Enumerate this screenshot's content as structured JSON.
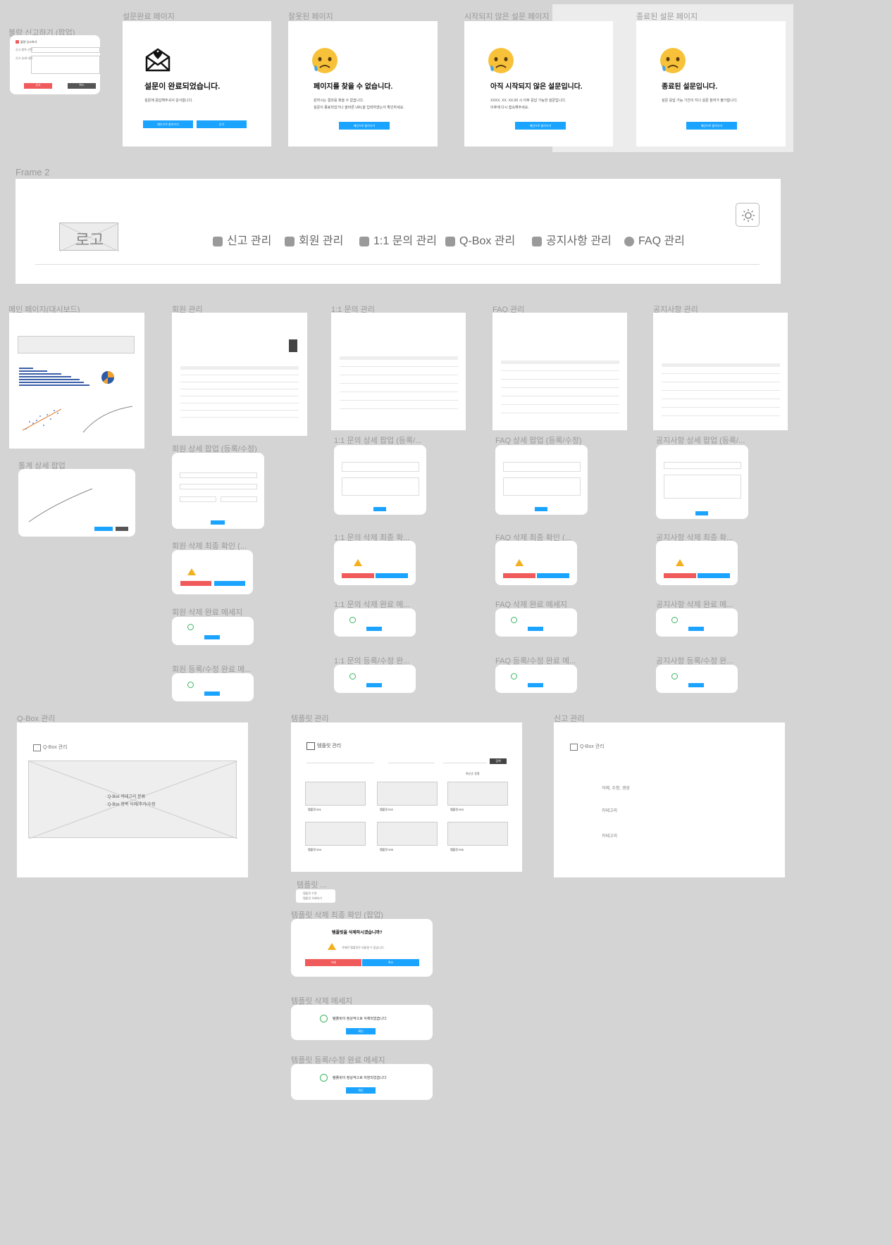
{
  "top": {
    "report_popup": {
      "label": "불량 신고하기 (팝업)",
      "title": "불량 신고하기",
      "field1": "신고 항목 선택",
      "field2": "신고 상세 내용",
      "cancel": "신고",
      "confirm": "취소"
    },
    "complete": {
      "label": "설문완료 페이지",
      "heading": "설문이 완료되었습니다.",
      "sub": "설문에 응답해주셔서 감사합니다.",
      "btn1": "메인으로 돌아가기",
      "btn2": "닫기"
    },
    "notfound": {
      "label": "잘못된 페이지",
      "heading": "페이지를 찾을 수 없습니다.",
      "sub1": "원하시는 결과를 찾을 수 없습니다.",
      "sub2": "설문이 종료되었거나 올바른 URL을 입력하였는지 확인하세요.",
      "btn": "메인으로 돌아가기"
    },
    "notstarted": {
      "label": "시작되지 않은 설문 페이지",
      "heading": "아직 시작되지 않은 설문입니다.",
      "sub1": "XXXX. XX. XX.00 시 이후 응답 가능한 설문입니다.",
      "sub2": "이후에 다시 접속해주세요.",
      "btn": "메인으로 돌아가기"
    },
    "ended": {
      "label": "종료된 설문 페이지",
      "heading": "종료된 설문입니다.",
      "sub": "설문 응답 가능 기간이 지나 설문 참여가 불가합니다.",
      "btn": "메인으로 돌아가기"
    }
  },
  "frame2": {
    "label": "Frame 2",
    "logo": "로고",
    "nav": [
      "신고 관리",
      "회원 관리",
      "1:1 문의 관리",
      "Q-Box 관리",
      "공지사항 관리",
      "FAQ 관리"
    ]
  },
  "labels": {
    "dashboard": "메인 페이지(대시보드)",
    "members": "회원 관리",
    "inquiry": "1:1 문의 관리",
    "faq": "FAQ 관리",
    "notice": "공지사항 관리",
    "stats_popup": "통계 상세 팝업",
    "member_detail": "회원 상세 팝업 (등록/수정)",
    "member_delete_confirm": "회원 삭제 최종 확인 (...",
    "member_delete_done": "회원 삭제 완료 메세지",
    "member_save_done": "회원 등록/수정 완료 메...",
    "inquiry_detail": "1:1 문의 상세 팝업 (등록/...",
    "faq_detail": "FAQ 상세 팝업 (등록/수정)",
    "notice_detail": "공지사항 상세 팝업 (등록/...",
    "inquiry_delete_confirm": "1:1 문의 삭제 최종 확...",
    "faq_delete_confirm": "FAQ 삭제 최종 확인 (...",
    "notice_delete_confirm": "공지사항 삭제 최종 확...",
    "inquiry_delete_done": "1:1 문의 삭제 완료 메...",
    "faq_delete_done": "FAQ 삭제 완료 메세지",
    "notice_delete_done": "공지사항 삭제 완료 메...",
    "inquiry_save_done": "1:1 문의 등록/수정 완...",
    "faq_save_done": "FAQ 등록/수정 완료 메...",
    "notice_save_done": "공지사항 등록/수정 완...",
    "qbox": "Q-Box 관리",
    "template": "템플릿 관리",
    "report": "신고 관리",
    "template_menu": "템플릿 ...",
    "template_delete_confirm": "템플릿 삭제 최종 확인 (팝업)",
    "template_delete_msg": "템플릿 삭제 메세지",
    "template_save_msg": "템플릿 등록/수정 완료 메세지"
  },
  "qbox": {
    "title": "Q-Box 관리",
    "bullet1": "Q-Box 카테고리 분류",
    "bullet2": "Q-Box 항목 삭제/추가/수정"
  },
  "template": {
    "title": "템플릿 관리",
    "search_btn": "검색",
    "sort": "최신순 정렬",
    "cards": [
      "템플릿 001",
      "템플릿 002",
      "템플릿 003",
      "템플릿 004",
      "템플릿 005",
      "템플릿 006"
    ],
    "menu": [
      "템플릿 수정",
      "템플릿 삭제하기"
    ],
    "delete_q": "템플릿을 삭제하시겠습니까?",
    "delete_warn": "삭제된 템플릿은 되돌릴 수 없습니다.",
    "delete_btn": "삭제",
    "cancel_btn": "취소",
    "deleted_msg": "템플릿이 정상적으로 삭제되었습니다",
    "saved_msg": "템플릿이 정상적으로 저장되었습니다",
    "ok_btn": "확인"
  },
  "report": {
    "title": "Q-Box 관리",
    "items": [
      "삭제, 수정, 생성",
      "카테고리",
      "카테고리"
    ]
  }
}
